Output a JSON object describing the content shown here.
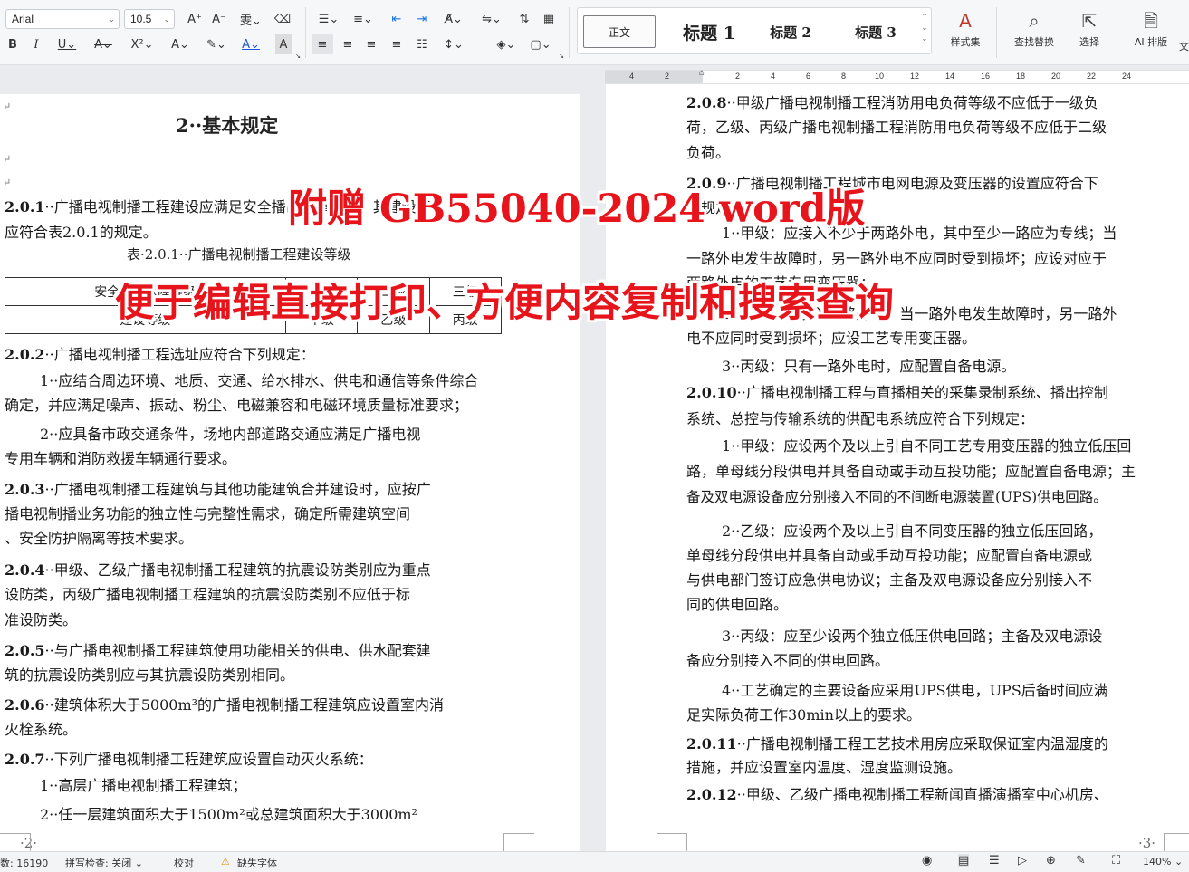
{
  "toolbar": {
    "font_name": "Arial",
    "font_size": "10.5",
    "row1_icons": [
      "A⁺",
      "A⁻",
      "wén",
      "eraser"
    ],
    "row2_format": [
      "B",
      "I",
      "U",
      "S",
      "X²",
      "A",
      "highlight",
      "A",
      "A"
    ],
    "styles": [
      "正文",
      "标题 1",
      "标题 2",
      "标题 3"
    ],
    "style_set_label": "样式集",
    "find_replace_label": "查找替换",
    "select_label": "选择",
    "ai_layout_label": "AI 排版",
    "accent_color": "#1a73e8"
  },
  "ruler": {
    "labels": [
      "4",
      "2",
      "2",
      "4",
      "6",
      "8",
      "10",
      "12",
      "14",
      "16",
      "18",
      "20",
      "22",
      "24"
    ]
  },
  "left_page": {
    "title": "2··基本规定",
    "p201_num": "2.0.1",
    "p201_text1": "··广播电视制播工程建设应满足安全播出保障要求，其建设等级",
    "p201_text2": "应符合表2.0.1的规定。",
    "table_caption": "表·2.0.1··广播电视制播工程建设等级",
    "table_row1": [
      "安全播出保障等级",
      "一级",
      "二级",
      "三级"
    ],
    "table_row2": [
      "建设等级",
      "甲级",
      "乙级",
      "丙级"
    ],
    "p202_num": "2.0.2",
    "p202_text": "··广播电视制播工程选址应符合下列规定：",
    "p202_1a": "1··应结合周边环境、地质、交通、给水排水、供电和通信等条件综合",
    "p202_1b": "确定，并应满足噪声、振动、粉尘、电磁兼容和电磁环境质量标准要求；",
    "p202_2a": "2··应具备市政交通条件，场地内部道路交通应满足广播电视",
    "p202_2b": "专用车辆和消防救援车辆通行要求。",
    "p203_num": "2.0.3",
    "p203_a": "··广播电视制播工程建筑与其他功能建筑合并建设时，应按广",
    "p203_b": "播电视制播业务功能的独立性与完整性需求，确定所需建筑空间",
    "p203_c": "、安全防护隔离等技术要求。",
    "p204_num": "2.0.4",
    "p204_a": "··甲级、乙级广播电视制播工程建筑的抗震设防类别应为重点",
    "p204_b": "设防类，丙级广播电视制播工程建筑的抗震设防类别不应低于标",
    "p204_c": "准设防类。",
    "p205_num": "2.0.5",
    "p205_a": "··与广播电视制播工程建筑使用功能相关的供电、供水配套建",
    "p205_b": "筑的抗震设防类别应与其抗震设防类别相同。",
    "p206_num": "2.0.6",
    "p206_a": "··建筑体积大于5000m³的广播电视制播工程建筑应设置室内消",
    "p206_b": "火栓系统。",
    "p207_num": "2.0.7",
    "p207_a": "··下列广播电视制播工程建筑应设置自动灭火系统：",
    "p207_1": "1··高层广播电视制播工程建筑；",
    "p207_2": "2··任一层建筑面积大于1500m²或总建筑面积大于3000m²",
    "page_number": "·2·"
  },
  "right_page": {
    "p208_num": "2.0.8",
    "p208_a": "··甲级广播电视制播工程消防用电负荷等级不应低于一级负",
    "p208_b": "荷，乙级、丙级广播电视制播工程消防用电负荷等级不应低于二级",
    "p208_c": "负荷。",
    "p209_num": "2.0.9",
    "p209_a": "··广播电视制播工程城市电网电源及变压器的设置应符合下",
    "p209_b": "列规定：",
    "p209_1a": "1··甲级：应接入不少于两路外电，其中至少一路应为专线；当",
    "p209_1b": "一路外电发生故障时，另一路外电不应同时受到损坏；应设对应于",
    "p209_1c": "两路外电的工艺专用变压器；",
    "p209_2a": "2··乙级：应接入两路外电，当一路外电发生故障时，另一路外",
    "p209_2b": "电不应同时受到损坏；应设工艺专用变压器。",
    "p209_3": "3··丙级：只有一路外电时，应配置自备电源。",
    "p2010_num": "2.0.10",
    "p2010_a": "··广播电视制播工程与直播相关的采集录制系统、播出控制",
    "p2010_b": "系统、总控与传输系统的供配电系统应符合下列规定：",
    "p2010_1a": "1··甲级：应设两个及以上引自不同工艺专用变压器的独立低压回",
    "p2010_1b": "路，单母线分段供电并具备自动或手动互投功能；应配置自备电源；主",
    "p2010_1c": "备及双电源设备应分别接入不同的不间断电源装置(UPS)供电回路。",
    "p2010_2a": "2··乙级：应设两个及以上引自不同变压器的独立低压回路，",
    "p2010_2b": "单母线分段供电并具备自动或手动互投功能；应配置自备电源或",
    "p2010_2c": "与供电部门签订应急供电协议；主备及双电源设备应分别接入不",
    "p2010_2d": "同的供电回路。",
    "p2010_3a": "3··丙级：应至少设两个独立低压供电回路；主备及双电源设",
    "p2010_3b": "备应分别接入不同的供电回路。",
    "p2010_4a": "4··工艺确定的主要设备应采用UPS供电，UPS后备时间应满",
    "p2010_4b": "足实际负荷工作30min以上的要求。",
    "p2011_num": "2.0.11",
    "p2011_a": "··广播电视制播工程工艺技术用房应采取保证室内温湿度的",
    "p2011_b": "措施，并应设置室内温度、湿度监测设施。",
    "p2012_num": "2.0.12",
    "p2012_a": "··甲级、乙级广播电视制播工程新闻直播演播室中心机房、",
    "page_number": "·3·"
  },
  "banner": {
    "line1": "附赠 GB55040-2024 word版",
    "line2": "便于编辑直接打印、方便内容复制和搜索查询",
    "color": "#e8141b"
  },
  "status": {
    "word_count": "数: 16190",
    "spell_check": "拼写检查: 关闭",
    "proofread": "校对",
    "missing_font": "缺失字体",
    "zoom": "140%"
  }
}
